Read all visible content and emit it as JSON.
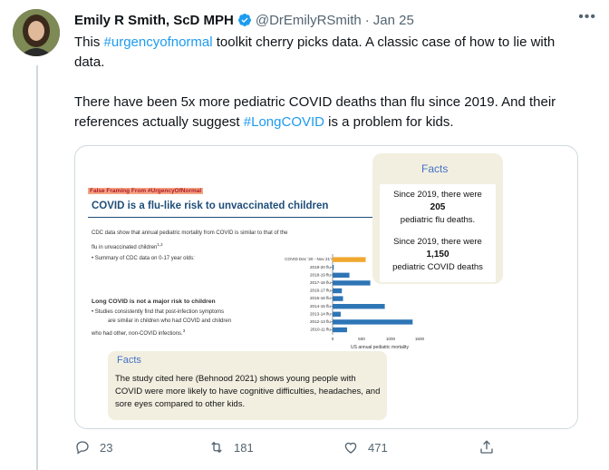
{
  "author": {
    "name": "Emily R Smith, ScD MPH",
    "handle": "@DrEmilyRSmith",
    "separator": "·",
    "date": "Jan 25"
  },
  "more_label": "•••",
  "tweet": {
    "p1_prefix": "This ",
    "p1_hashtag": "#urgencyofnormal",
    "p1_suffix": " toolkit cherry picks data. A classic case of how to lie with data.",
    "p2_prefix": "There have been 5x more pediatric COVID deaths than flu since 2019. And their references actually suggest ",
    "p2_hashtag": "#LongCOVID",
    "p2_suffix": " is a problem for kids."
  },
  "media": {
    "slide": {
      "tag": "False Framing From #UrgencyOfNormal",
      "title": "COVID is a flu-like risk to unvaccinated children",
      "cdc_line1": "CDC data show that annual pediatric mortality from COVID is similar to that of the",
      "cdc_line2": "flu in unvaccinated children",
      "cdc_sup": "1,2",
      "bullet1": "• Summary of CDC data on 0-17 year olds:",
      "long_covid_heading": "Long COVID is not a major risk to children",
      "bullet2a": "• Studies consistently find that post-infection symptoms",
      "bullet2b": "are similar in children who had COVID and children",
      "bullet2c": "who had other, non-COVID infections.",
      "bullet2_sup": "3"
    },
    "facts_top": {
      "heading": "Facts",
      "l1": "Since 2019, there were",
      "v1": "205",
      "l2": "pediatric flu deaths.",
      "l3": "Since 2019, there were",
      "v2": "1,150",
      "l4": "pediatric COVID deaths"
    },
    "facts_bottom": {
      "heading": "Facts",
      "body": "The study cited here (Behnood 2021) shows young people with COVID were more likely to have cognitive difficulties, headaches, and sore eyes compared to other kids."
    }
  },
  "chart_data": {
    "type": "bar",
    "orientation": "horizontal",
    "categories": [
      "COVID Dec '20 - Nov 21'",
      "2019-20 flu",
      "2018-19 flu",
      "2017-18 flu",
      "2016-17 flu",
      "2015-16 flu",
      "2014-15 flu",
      "2013-14 flu",
      "2012-13 flu",
      "2010-11 flu"
    ],
    "values": [
      570,
      20,
      290,
      650,
      160,
      180,
      900,
      140,
      1380,
      250
    ],
    "colors": [
      "#f0a830",
      "#2e75b6",
      "#2e75b6",
      "#2e75b6",
      "#2e75b6",
      "#2e75b6",
      "#2e75b6",
      "#2e75b6",
      "#2e75b6",
      "#2e75b6"
    ],
    "xticks": [
      "0",
      "500",
      "1000",
      "1500"
    ],
    "xlim": [
      0,
      1500
    ],
    "xlabel": "US annual pediatric mortality"
  },
  "actions": {
    "reply": "23",
    "retweet": "181",
    "like": "471"
  },
  "colors": {
    "link": "#1d9bf0",
    "verified": "#1d9bf0",
    "muted": "#536471",
    "facts_bg": "#f2efe1",
    "facts_heading": "#4472c4"
  }
}
